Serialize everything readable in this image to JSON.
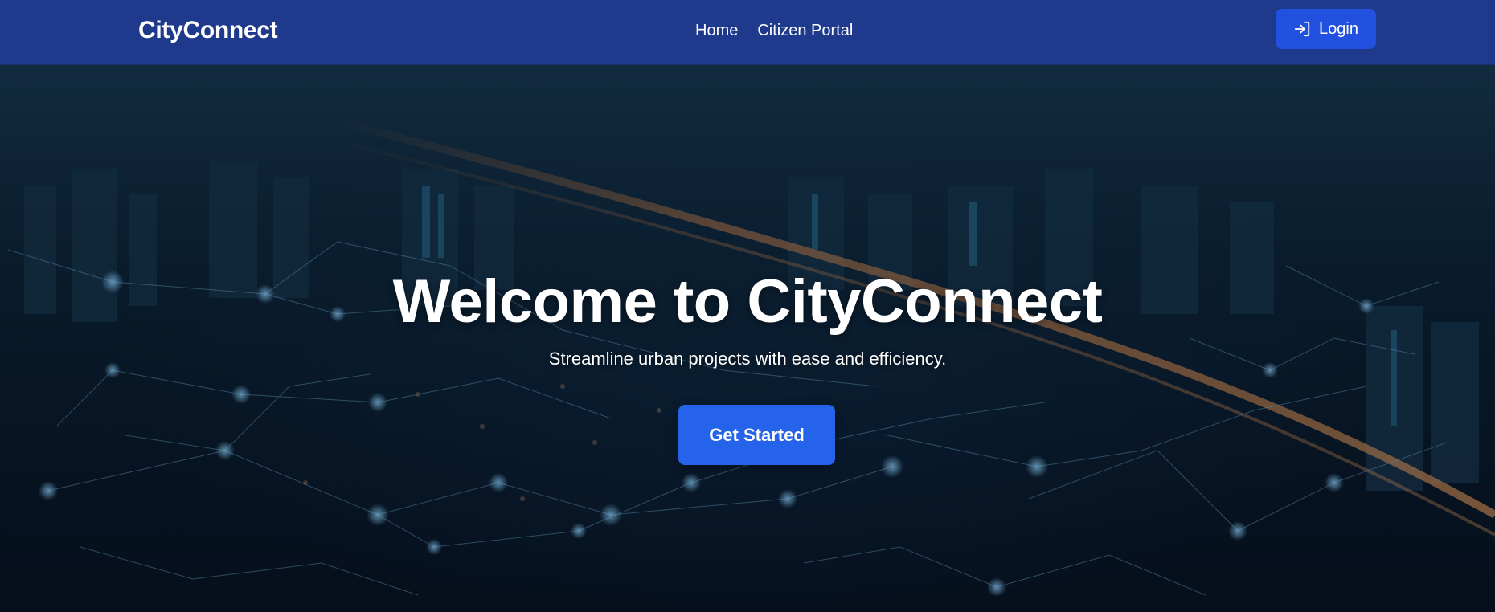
{
  "navbar": {
    "brand": "CityConnect",
    "links": [
      {
        "label": "Home"
      },
      {
        "label": "Citizen Portal"
      }
    ],
    "login_label": "Login",
    "login_icon": "login-arrow-icon"
  },
  "hero": {
    "title": "Welcome to CityConnect",
    "subtitle": "Streamline urban projects with ease and efficiency.",
    "cta_label": "Get Started",
    "background_image": "night city skyline with glowing network connection lines"
  },
  "colors": {
    "navbar_bg": "#1f3a8c",
    "login_button": "#2351df",
    "cta_button": "#2563eb",
    "text": "#ffffff"
  }
}
